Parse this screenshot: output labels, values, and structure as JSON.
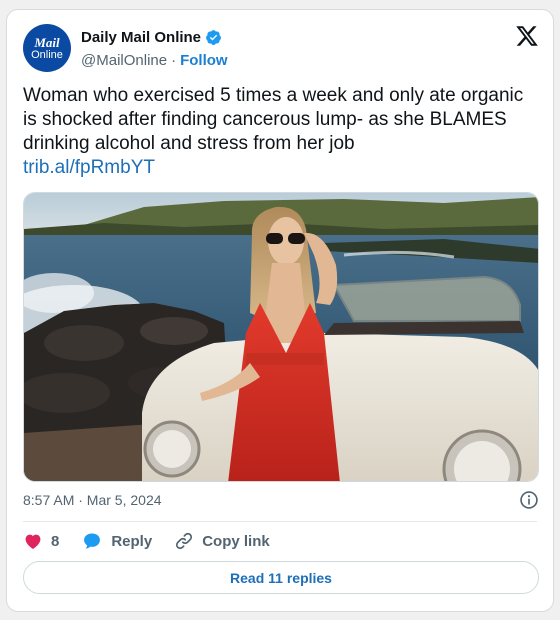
{
  "author": {
    "display_name": "Daily Mail Online",
    "handle": "@MailOnline",
    "follow_label": "Follow",
    "separator": "·",
    "avatar_line1": "Mail",
    "avatar_line2": "Online",
    "verified_icon": "verified-badge-icon",
    "brand_color": "#0b4aa2"
  },
  "platform_icon": "x-logo-icon",
  "tweet": {
    "text": "Woman who exercised 5 times a week and only ate organic is shocked after finding cancerous lump- as she BLAMES drinking alcohol and stress from her job",
    "link": "trib.al/fpRmbYT",
    "media_icon": "photo-woman-red-dress-vintage-car"
  },
  "meta": {
    "timestamp": "8:57 AM · Mar 5, 2024",
    "info_icon": "info-icon"
  },
  "actions": {
    "like_count": "8",
    "reply_label": "Reply",
    "copy_link_label": "Copy link",
    "like_color": "#e0245e",
    "reply_color": "#1d9bf0"
  },
  "footer": {
    "read_replies_label": "Read 11 replies"
  }
}
